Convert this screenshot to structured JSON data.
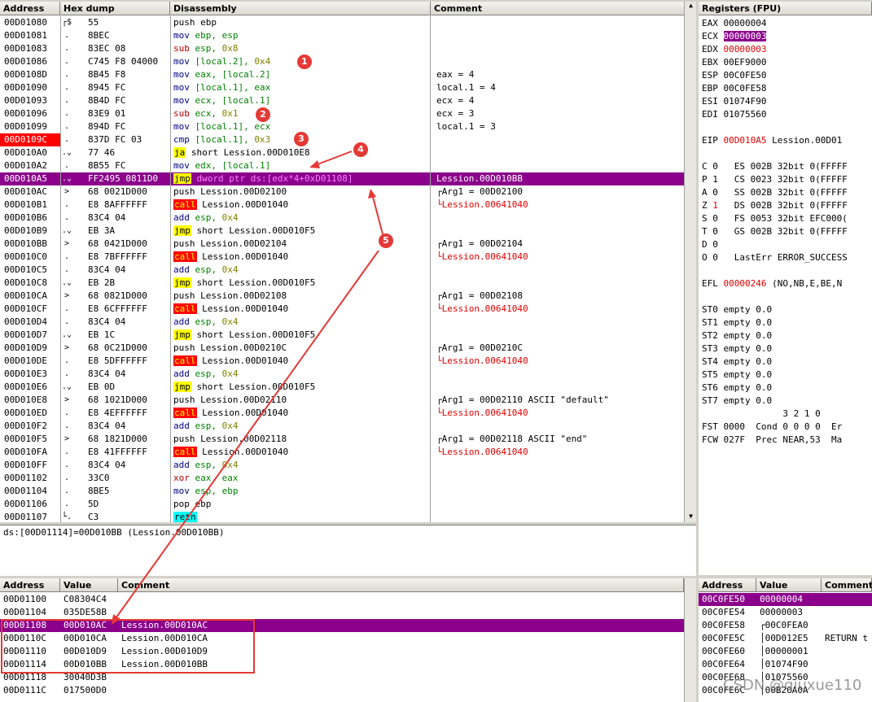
{
  "colors": {
    "highlight": "#8b008b",
    "annotation": "#e53935"
  },
  "cpu": {
    "headers": {
      "address": "Address",
      "hex": "Hex dump",
      "disasm": "Disassembly",
      "comment": "Comment"
    },
    "rows": [
      {
        "addr": "00D01080",
        "mark": "┌$",
        "hex": "55",
        "dis": [
          [
            "push ebp",
            ""
          ]
        ],
        "cm": ""
      },
      {
        "addr": "00D01081",
        "mark": ".",
        "hex": "8BEC",
        "dis": [
          [
            "mov ",
            "navy"
          ],
          [
            "ebp, esp",
            "green"
          ]
        ],
        "cm": ""
      },
      {
        "addr": "00D01083",
        "mark": ".",
        "hex": "83EC 08",
        "dis": [
          [
            "sub ",
            "darkred"
          ],
          [
            "esp, ",
            "green"
          ],
          [
            "0x8",
            "olive"
          ]
        ],
        "cm": ""
      },
      {
        "addr": "00D01086",
        "mark": ".",
        "hex": "C745 F8 04000",
        "dis": [
          [
            "mov ",
            "navy"
          ],
          [
            "[local.2], ",
            "green"
          ],
          [
            "0x4",
            "olive"
          ]
        ],
        "cm": ""
      },
      {
        "addr": "00D0108D",
        "mark": ".",
        "hex": "8B45 F8",
        "dis": [
          [
            "mov ",
            "navy"
          ],
          [
            "eax, [local.2]",
            "green"
          ]
        ],
        "cm": "eax = 4"
      },
      {
        "addr": "00D01090",
        "mark": ".",
        "hex": "8945 FC",
        "dis": [
          [
            "mov ",
            "navy"
          ],
          [
            "[local.1], eax",
            "green"
          ]
        ],
        "cm": "local.1 = 4"
      },
      {
        "addr": "00D01093",
        "mark": ".",
        "hex": "8B4D FC",
        "dis": [
          [
            "mov ",
            "navy"
          ],
          [
            "ecx, [local.1]",
            "green"
          ]
        ],
        "cm": "ecx = 4"
      },
      {
        "addr": "00D01096",
        "mark": ".",
        "hex": "83E9 01",
        "dis": [
          [
            "sub ",
            "darkred"
          ],
          [
            "ecx, ",
            "green"
          ],
          [
            "0x1",
            "olive"
          ]
        ],
        "cm": "ecx = 3"
      },
      {
        "addr": "00D01099",
        "mark": ".",
        "hex": "894D FC",
        "dis": [
          [
            "mov ",
            "navy"
          ],
          [
            "[local.1], ecx",
            "green"
          ]
        ],
        "cm": "local.1 = 3"
      },
      {
        "addr": "00D0109C",
        "mark": ".",
        "hex": "837D FC 03",
        "dis": [
          [
            "cmp ",
            "navy"
          ],
          [
            "[local.1], ",
            "green"
          ],
          [
            "0x3",
            "olive"
          ]
        ],
        "cm": "",
        "addrRed": true
      },
      {
        "addr": "00D010A0",
        "mark": ".⌄",
        "hex": "77 46",
        "dis": [
          [
            "ja",
            "ja"
          ],
          [
            " short Lession.00D010E8",
            ""
          ]
        ],
        "cm": ""
      },
      {
        "addr": "00D010A2",
        "mark": ".",
        "hex": "8B55 FC",
        "dis": [
          [
            "mov ",
            "navy"
          ],
          [
            "edx, [local.1]",
            "green"
          ]
        ],
        "cm": ""
      },
      {
        "addr": "00D010A5",
        "mark": ".⌄",
        "hex": "FF2495 0811D0",
        "dis": [
          [
            "jmp",
            "jmp"
          ],
          [
            " dword ptr ds:[edx*4+0xD01108]",
            ""
          ]
        ],
        "cm": "Lession.00D010BB",
        "hl": true
      },
      {
        "addr": "00D010AC",
        "mark": ">",
        "hex": "68 0021D000",
        "dis": [
          [
            "push Lession.00D02100",
            ""
          ]
        ],
        "cm": "┌Arg1 = 00D02100"
      },
      {
        "addr": "00D010B1",
        "mark": ".",
        "hex": "E8 8AFFFFFF",
        "dis": [
          [
            "call",
            "call"
          ],
          [
            " Lession.00D01040",
            ""
          ]
        ],
        "cm": "└Lession.00641040",
        "cmRed": true
      },
      {
        "addr": "00D010B6",
        "mark": ".",
        "hex": "83C4 04",
        "dis": [
          [
            "add ",
            "navy"
          ],
          [
            "esp, ",
            "green"
          ],
          [
            "0x4",
            "olive"
          ]
        ],
        "cm": ""
      },
      {
        "addr": "00D010B9",
        "mark": ".⌄",
        "hex": "EB 3A",
        "dis": [
          [
            "jmp",
            "jmp"
          ],
          [
            " short Lession.00D010F5",
            ""
          ]
        ],
        "cm": ""
      },
      {
        "addr": "00D010BB",
        "mark": ">",
        "hex": "68 0421D000",
        "dis": [
          [
            "push Lession.00D02104",
            ""
          ]
        ],
        "cm": "┌Arg1 = 00D02104"
      },
      {
        "addr": "00D010C0",
        "mark": ".",
        "hex": "E8 7BFFFFFF",
        "dis": [
          [
            "call",
            "call"
          ],
          [
            " Lession.00D01040",
            ""
          ]
        ],
        "cm": "└Lession.00641040",
        "cmRed": true
      },
      {
        "addr": "00D010C5",
        "mark": ".",
        "hex": "83C4 04",
        "dis": [
          [
            "add ",
            "navy"
          ],
          [
            "esp, ",
            "green"
          ],
          [
            "0x4",
            "olive"
          ]
        ],
        "cm": ""
      },
      {
        "addr": "00D010C8",
        "mark": ".⌄",
        "hex": "EB 2B",
        "dis": [
          [
            "jmp",
            "jmp"
          ],
          [
            " short Lession.00D010F5",
            ""
          ]
        ],
        "cm": ""
      },
      {
        "addr": "00D010CA",
        "mark": ">",
        "hex": "68 0821D000",
        "dis": [
          [
            "push Lession.00D02108",
            ""
          ]
        ],
        "cm": "┌Arg1 = 00D02108"
      },
      {
        "addr": "00D010CF",
        "mark": ".",
        "hex": "E8 6CFFFFFF",
        "dis": [
          [
            "call",
            "call"
          ],
          [
            " Lession.00D01040",
            ""
          ]
        ],
        "cm": "└Lession.00641040",
        "cmRed": true
      },
      {
        "addr": "00D010D4",
        "mark": ".",
        "hex": "83C4 04",
        "dis": [
          [
            "add ",
            "navy"
          ],
          [
            "esp, ",
            "green"
          ],
          [
            "0x4",
            "olive"
          ]
        ],
        "cm": ""
      },
      {
        "addr": "00D010D7",
        "mark": ".⌄",
        "hex": "EB 1C",
        "dis": [
          [
            "jmp",
            "jmp"
          ],
          [
            " short Lession.00D010F5",
            ""
          ]
        ],
        "cm": ""
      },
      {
        "addr": "00D010D9",
        "mark": ">",
        "hex": "68 0C21D000",
        "dis": [
          [
            "push Lession.00D0210C",
            ""
          ]
        ],
        "cm": "┌Arg1 = 00D0210C"
      },
      {
        "addr": "00D010DE",
        "mark": ".",
        "hex": "E8 5DFFFFFF",
        "dis": [
          [
            "call",
            "call"
          ],
          [
            " Lession.00D01040",
            ""
          ]
        ],
        "cm": "└Lession.00641040",
        "cmRed": true
      },
      {
        "addr": "00D010E3",
        "mark": ".",
        "hex": "83C4 04",
        "dis": [
          [
            "add ",
            "navy"
          ],
          [
            "esp, ",
            "green"
          ],
          [
            "0x4",
            "olive"
          ]
        ],
        "cm": ""
      },
      {
        "addr": "00D010E6",
        "mark": ".⌄",
        "hex": "EB 0D",
        "dis": [
          [
            "jmp",
            "jmp"
          ],
          [
            " short Lession.00D010F5",
            ""
          ]
        ],
        "cm": ""
      },
      {
        "addr": "00D010E8",
        "mark": ">",
        "hex": "68 1021D000",
        "dis": [
          [
            "push Lession.00D02110",
            ""
          ]
        ],
        "cm": "┌Arg1 = 00D02110 ASCII \"default\""
      },
      {
        "addr": "00D010ED",
        "mark": ".",
        "hex": "E8 4EFFFFFF",
        "dis": [
          [
            "call",
            "call"
          ],
          [
            " Lession.00D01040",
            ""
          ]
        ],
        "cm": "└Lession.00641040",
        "cmRed": true
      },
      {
        "addr": "00D010F2",
        "mark": ".",
        "hex": "83C4 04",
        "dis": [
          [
            "add ",
            "navy"
          ],
          [
            "esp, ",
            "green"
          ],
          [
            "0x4",
            "olive"
          ]
        ],
        "cm": ""
      },
      {
        "addr": "00D010F5",
        "mark": ">",
        "hex": "68 1821D000",
        "dis": [
          [
            "push Lession.00D02118",
            ""
          ]
        ],
        "cm": "┌Arg1 = 00D02118 ASCII \"end\""
      },
      {
        "addr": "00D010FA",
        "mark": ".",
        "hex": "E8 41FFFFFF",
        "dis": [
          [
            "call",
            "call"
          ],
          [
            " Lession.00D01040",
            ""
          ]
        ],
        "cm": "└Lession.00641040",
        "cmRed": true
      },
      {
        "addr": "00D010FF",
        "mark": ".",
        "hex": "83C4 04",
        "dis": [
          [
            "add ",
            "navy"
          ],
          [
            "esp, ",
            "green"
          ],
          [
            "0x4",
            "olive"
          ]
        ],
        "cm": ""
      },
      {
        "addr": "00D01102",
        "mark": ".",
        "hex": "33C0",
        "dis": [
          [
            "xor ",
            "darkred"
          ],
          [
            "eax, eax",
            "green"
          ]
        ],
        "cm": ""
      },
      {
        "addr": "00D01104",
        "mark": ".",
        "hex": "8BE5",
        "dis": [
          [
            "mov ",
            "navy"
          ],
          [
            "esp, ebp",
            "green"
          ]
        ],
        "cm": ""
      },
      {
        "addr": "00D01106",
        "mark": ".",
        "hex": "5D",
        "dis": [
          [
            "pop ebp",
            ""
          ]
        ],
        "cm": ""
      },
      {
        "addr": "00D01107",
        "mark": "└.",
        "hex": "C3",
        "dis": [
          [
            "retn",
            "retn"
          ]
        ],
        "cm": ""
      }
    ]
  },
  "info_line": "ds:[00D01114]=00D010BB (Lession.00D010BB)",
  "registers": {
    "title": "Registers (FPU)",
    "lines": [
      {
        "t": "EAX 00000004"
      },
      {
        "t": "ECX ",
        "v": "00000003",
        "vc": "hl"
      },
      {
        "t": "EDX ",
        "v": "00000003",
        "vc": "red"
      },
      {
        "t": "EBX 00EF9000"
      },
      {
        "t": "ESP 00C0FE50"
      },
      {
        "t": "EBP 00C0FE58"
      },
      {
        "t": "ESI 01074F90"
      },
      {
        "t": "EDI 01075560"
      },
      {
        "t": ""
      },
      {
        "t": "EIP ",
        "v": "00D010A5",
        "vc": "red",
        "s": " Lession.00D01"
      },
      {
        "t": ""
      },
      {
        "t": "C 0   ES 002B 32bit 0(FFFFF"
      },
      {
        "t": "P 1   CS 0023 32bit 0(FFFFF"
      },
      {
        "t": "A 0   SS 002B 32bit 0(FFFFF"
      },
      {
        "t": "Z ",
        "v": "1",
        "vc": "red",
        "s": "   DS 002B 32bit 0(FFFFF"
      },
      {
        "t": "S 0   FS 0053 32bit EFC000("
      },
      {
        "t": "T 0   GS 002B 32bit 0(FFFFF"
      },
      {
        "t": "D 0"
      },
      {
        "t": "O 0   LastErr ERROR_SUCCESS"
      },
      {
        "t": ""
      },
      {
        "t": "EFL ",
        "v": "00000246",
        "vc": "red",
        "s": " (NO,NB,E,BE,N"
      },
      {
        "t": ""
      },
      {
        "t": "ST0 empty 0.0"
      },
      {
        "t": "ST1 empty 0.0"
      },
      {
        "t": "ST2 empty 0.0"
      },
      {
        "t": "ST3 empty 0.0"
      },
      {
        "t": "ST4 empty 0.0"
      },
      {
        "t": "ST5 empty 0.0"
      },
      {
        "t": "ST6 empty 0.0"
      },
      {
        "t": "ST7 empty 0.0"
      },
      {
        "t": "               3 2 1 0"
      },
      {
        "t": "FST 0000  Cond 0 0 0 0  Er"
      },
      {
        "t": "FCW 027F  Prec NEAR,53  Ma"
      }
    ]
  },
  "dump": {
    "headers": {
      "address": "Address",
      "value": "Value",
      "comment": "Comment"
    },
    "rows": [
      {
        "addr": "00D01100",
        "val": "C08304C4",
        "cm": ""
      },
      {
        "addr": "00D01104",
        "val": "035DE58B",
        "cm": ""
      },
      {
        "addr": "00D01108",
        "val": "00D010AC",
        "cm": "Lession.00D010AC",
        "hl": true
      },
      {
        "addr": "00D0110C",
        "val": "00D010CA",
        "cm": "Lession.00D010CA"
      },
      {
        "addr": "00D01110",
        "val": "00D010D9",
        "cm": "Lession.00D010D9"
      },
      {
        "addr": "00D01114",
        "val": "00D010BB",
        "cm": "Lession.00D010BB"
      },
      {
        "addr": "00D01118",
        "val": "30040D3B",
        "cm": ""
      },
      {
        "addr": "00D0111C",
        "val": "017500D0",
        "cm": ""
      }
    ]
  },
  "stack": {
    "headers": {
      "address": "Address",
      "value": "Value",
      "comment": "Comment"
    },
    "rows": [
      {
        "addr": "00C0FE50",
        "val": "00000004",
        "cm": "",
        "hl": true
      },
      {
        "addr": "00C0FE54",
        "val": "00000003",
        "cm": ""
      },
      {
        "addr": "00C0FE58",
        "val": "┌00C0FEA0",
        "cm": ""
      },
      {
        "addr": "00C0FE5C",
        "val": "│00D012E5",
        "cm": "RETURN t"
      },
      {
        "addr": "00C0FE60",
        "val": "│00000001",
        "cm": ""
      },
      {
        "addr": "00C0FE64",
        "val": "│01074F90",
        "cm": ""
      },
      {
        "addr": "00C0FE68",
        "val": "│01075560",
        "cm": ""
      },
      {
        "addr": "00C0FE6C",
        "val": "│00B20A0A",
        "cm": ""
      }
    ]
  },
  "watermark": "CSDN @qiuxue110",
  "annotations": [
    "1",
    "2",
    "3",
    "4",
    "5"
  ]
}
